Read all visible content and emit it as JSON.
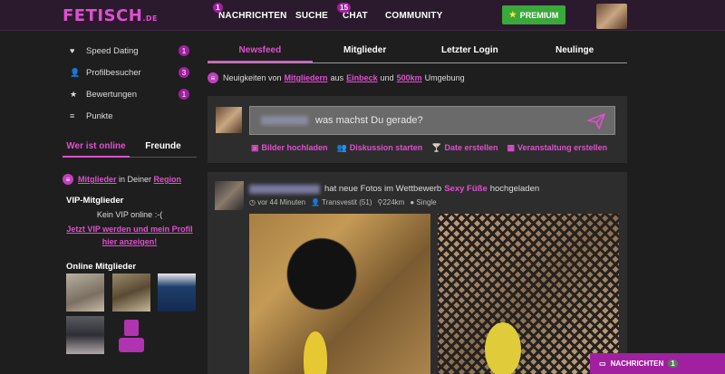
{
  "topnav": {
    "logo": "FETISCH",
    "logo_suffix": ".DE",
    "items": [
      {
        "label": "NACHRICHTEN",
        "badge": "1"
      },
      {
        "label": "SUCHE",
        "badge": ""
      },
      {
        "label": "CHAT",
        "badge": "15"
      },
      {
        "label": "COMMUNITY",
        "badge": ""
      }
    ],
    "premium_label": "PREMIUM"
  },
  "sidebar": {
    "links": [
      {
        "label": "Speed Dating",
        "count": "1",
        "icon": "heart-icon"
      },
      {
        "label": "Profilbesucher",
        "count": "3",
        "icon": "user-icon"
      },
      {
        "label": "Bewertungen",
        "count": "1",
        "icon": "star-icon"
      },
      {
        "label": "Punkte",
        "count": "",
        "icon": "database-icon"
      }
    ],
    "tabs": [
      "Wer ist online",
      "Freunde"
    ],
    "region": {
      "link1": "Mitglieder",
      "mid": " in Deiner ",
      "link2": "Region"
    },
    "vip_title": "VIP-Mitglieder",
    "vip_none": "Kein VIP online :-(",
    "vip_cta": "Jetzt VIP werden und mein Profil hier anzeigen!",
    "online_title": "Online Mitglieder"
  },
  "main": {
    "tabs": [
      "Newsfeed",
      "Mitglieder",
      "Letzter Login",
      "Neulinge"
    ],
    "news": {
      "prefix": "Neuigkeiten von",
      "link1": "Mitgliedern",
      "mid1": "aus",
      "link2": "Einbeck",
      "mid2": "und",
      "link3": "500km",
      "suffix": "Umgebung"
    },
    "composer": {
      "placeholder": "was machst Du gerade?",
      "actions": [
        "Bilder hochladen",
        "Diskussion starten",
        "Date erstellen",
        "Veranstaltung erstellen"
      ]
    },
    "post": {
      "text": "hat neue Fotos im Wettbewerb",
      "link": "Sexy Füße",
      "text2": "hochgeladen",
      "time": "vor 44 Minuten",
      "type": "Transvestit (51)",
      "distance": "224km",
      "status": "Single"
    }
  },
  "msgbar": {
    "label": "NACHRICHTEN",
    "count": "1"
  },
  "colors": {
    "accent": "#e04fcf",
    "badge": "#a020a0",
    "premium": "#3aa83a"
  }
}
